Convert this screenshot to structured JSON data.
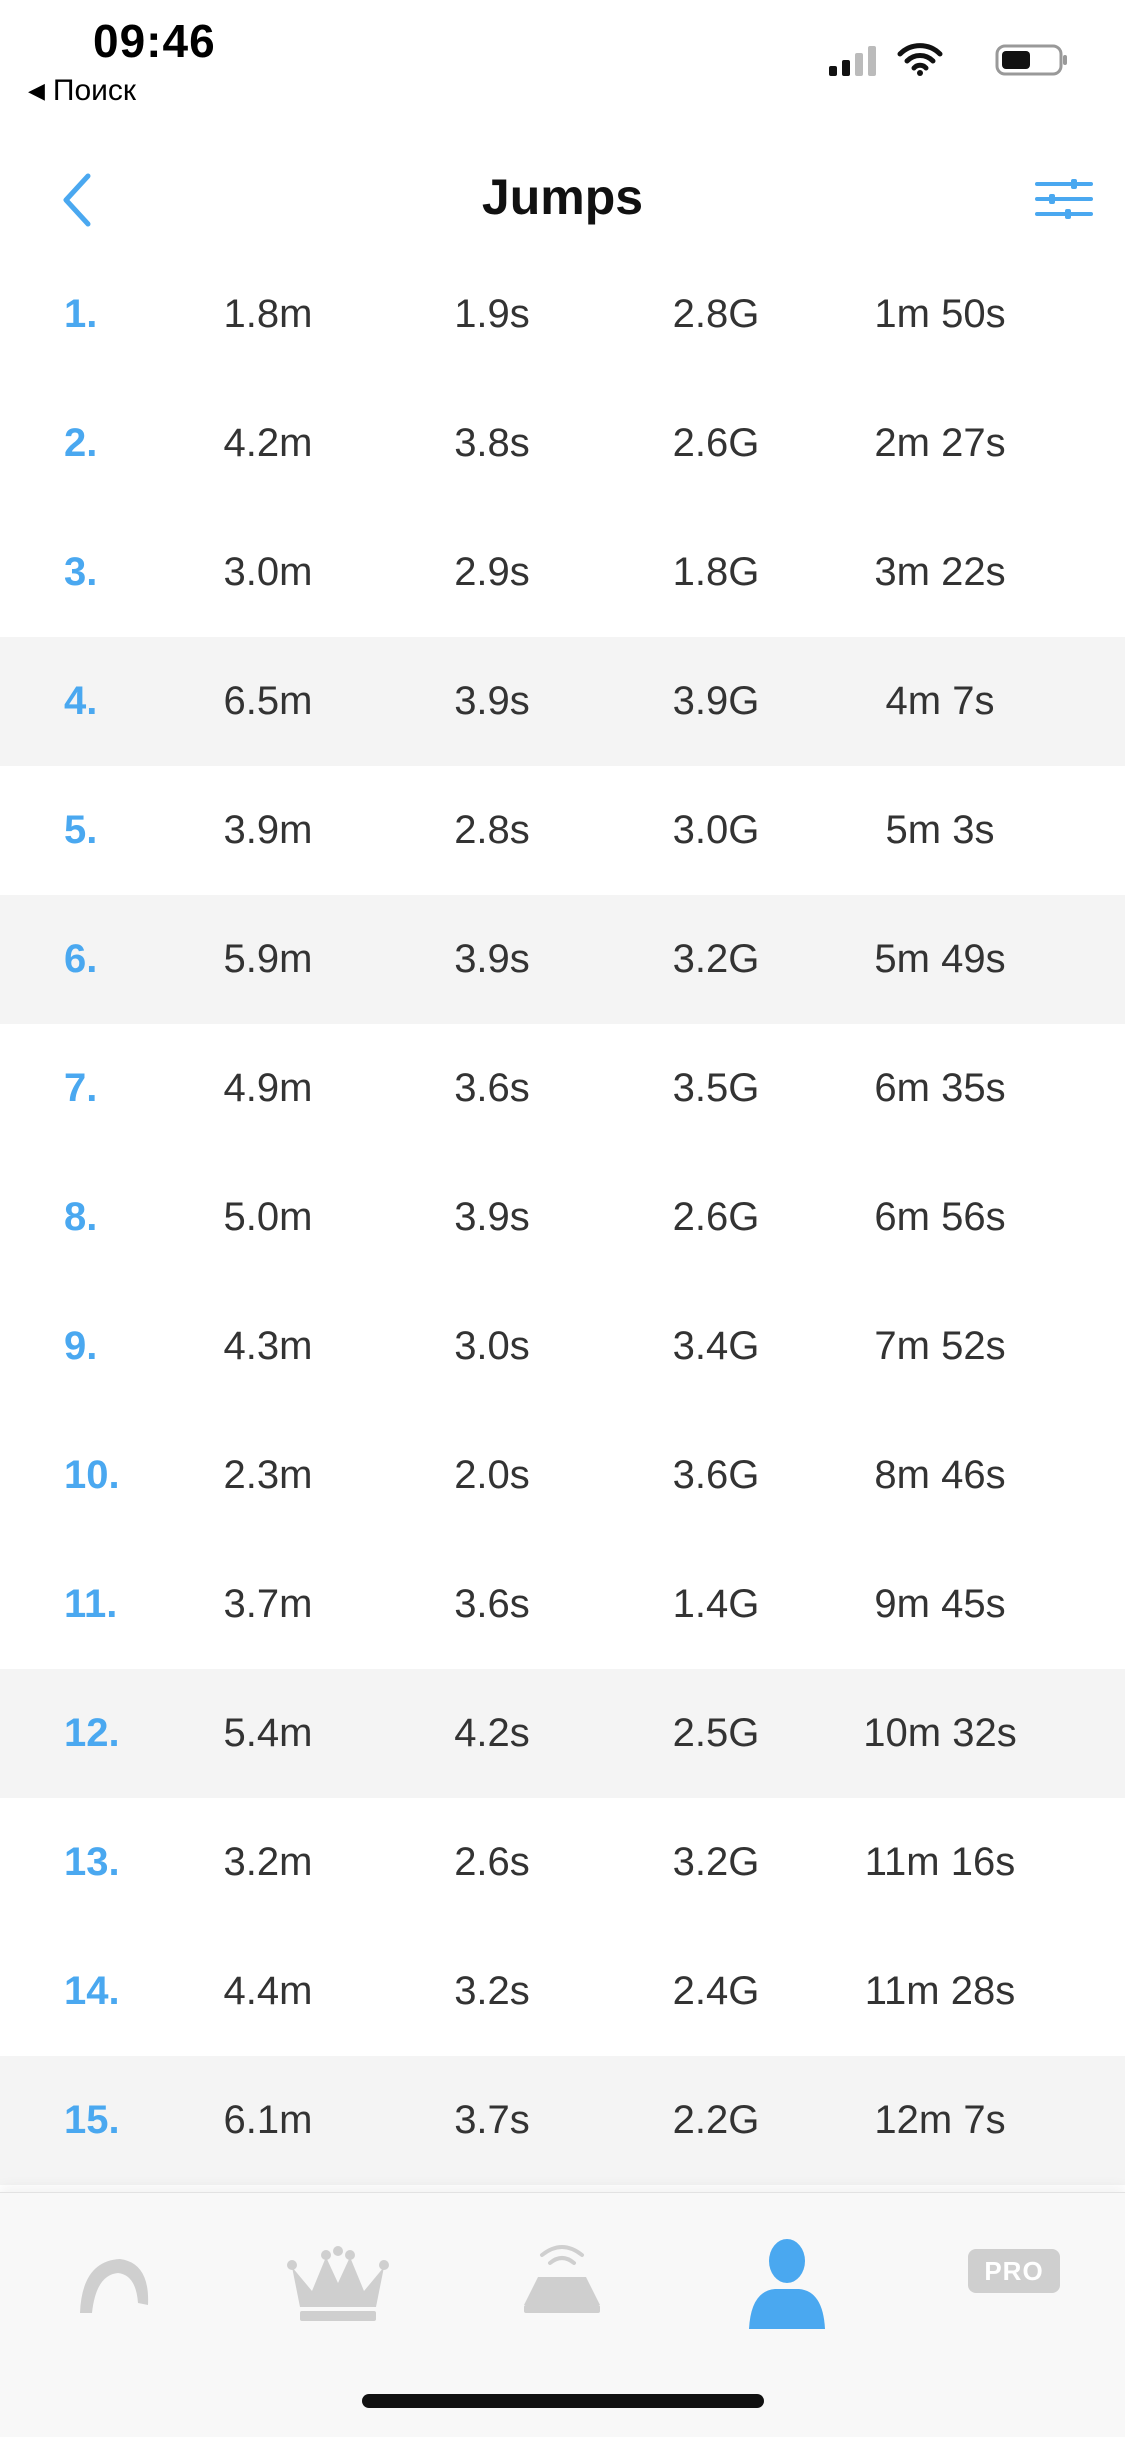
{
  "status_bar": {
    "time": "09:46",
    "back_label": "Поиск"
  },
  "nav": {
    "title": "Jumps"
  },
  "colors": {
    "accent": "#4aa8f0",
    "highlight_row": "#f4f4f4",
    "tab_inactive": "#cfcfcf"
  },
  "rows": [
    {
      "index": "1.",
      "distance": "1.8m",
      "airtime": "1.9s",
      "g_force": "2.8G",
      "time": "1m 50s",
      "highlight": false
    },
    {
      "index": "2.",
      "distance": "4.2m",
      "airtime": "3.8s",
      "g_force": "2.6G",
      "time": "2m 27s",
      "highlight": false
    },
    {
      "index": "3.",
      "distance": "3.0m",
      "airtime": "2.9s",
      "g_force": "1.8G",
      "time": "3m 22s",
      "highlight": false
    },
    {
      "index": "4.",
      "distance": "6.5m",
      "airtime": "3.9s",
      "g_force": "3.9G",
      "time": "4m 7s",
      "highlight": true
    },
    {
      "index": "5.",
      "distance": "3.9m",
      "airtime": "2.8s",
      "g_force": "3.0G",
      "time": "5m 3s",
      "highlight": false
    },
    {
      "index": "6.",
      "distance": "5.9m",
      "airtime": "3.9s",
      "g_force": "3.2G",
      "time": "5m 49s",
      "highlight": true
    },
    {
      "index": "7.",
      "distance": "4.9m",
      "airtime": "3.6s",
      "g_force": "3.5G",
      "time": "6m 35s",
      "highlight": false
    },
    {
      "index": "8.",
      "distance": "5.0m",
      "airtime": "3.9s",
      "g_force": "2.6G",
      "time": "6m 56s",
      "highlight": false
    },
    {
      "index": "9.",
      "distance": "4.3m",
      "airtime": "3.0s",
      "g_force": "3.4G",
      "time": "7m 52s",
      "highlight": false
    },
    {
      "index": "10.",
      "distance": "2.3m",
      "airtime": "2.0s",
      "g_force": "3.6G",
      "time": "8m 46s",
      "highlight": false
    },
    {
      "index": "11.",
      "distance": "3.7m",
      "airtime": "3.6s",
      "g_force": "1.4G",
      "time": "9m 45s",
      "highlight": false
    },
    {
      "index": "12.",
      "distance": "5.4m",
      "airtime": "4.2s",
      "g_force": "2.5G",
      "time": "10m 32s",
      "highlight": true
    },
    {
      "index": "13.",
      "distance": "3.2m",
      "airtime": "2.6s",
      "g_force": "3.2G",
      "time": "11m 16s",
      "highlight": false
    },
    {
      "index": "14.",
      "distance": "4.4m",
      "airtime": "3.2s",
      "g_force": "2.4G",
      "time": "11m 28s",
      "highlight": false
    },
    {
      "index": "15.",
      "distance": "6.1m",
      "airtime": "3.7s",
      "g_force": "2.2G",
      "time": "12m 7s",
      "highlight": true
    }
  ],
  "tabs": [
    {
      "icon": "kite-icon",
      "active": false
    },
    {
      "icon": "crown-icon",
      "active": false
    },
    {
      "icon": "device-icon",
      "active": false
    },
    {
      "icon": "profile-icon",
      "active": true
    },
    {
      "icon": "pro-badge",
      "label": "PRO",
      "active": false
    }
  ]
}
